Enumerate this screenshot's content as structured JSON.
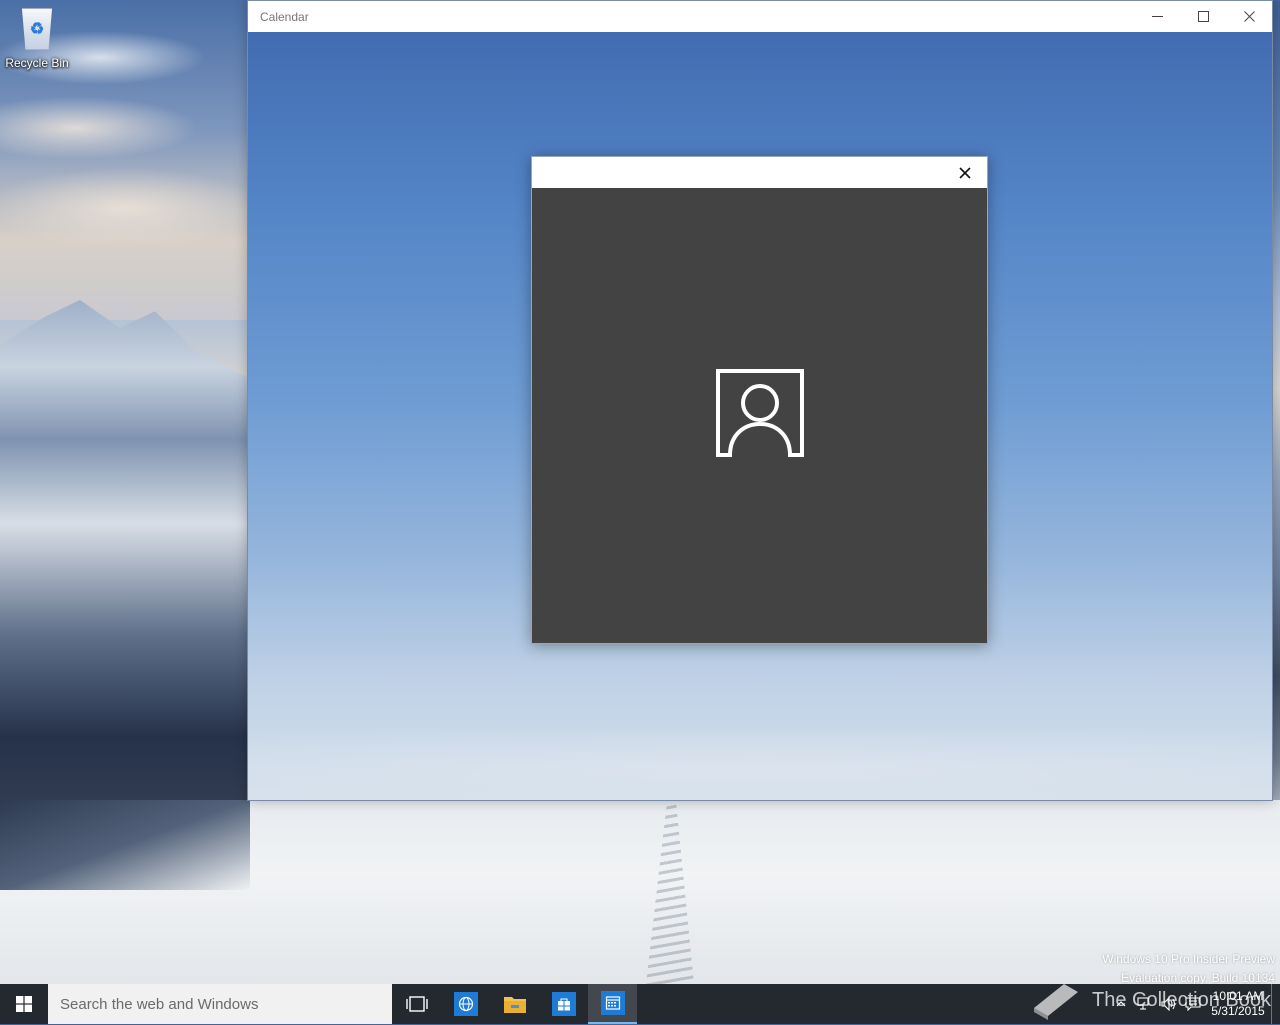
{
  "desktop": {
    "icons": [
      {
        "label": "Recycle Bin",
        "icon": "recycle-bin-icon"
      }
    ],
    "watermark": {
      "line1": "Windows 10 Pro Insider Preview",
      "line2": "Evaluation copy. Build 10134"
    },
    "site_watermark": "The Collection Book"
  },
  "window": {
    "title": "Calendar",
    "controls": {
      "minimize": "minimize-icon",
      "maximize": "maximize-icon",
      "close": "close-icon"
    }
  },
  "dialog": {
    "close_icon": "close-icon",
    "body_icon": "account-icon"
  },
  "taskbar": {
    "search_placeholder": "Search the web and Windows",
    "pinned": [
      {
        "name": "task-view",
        "icon": "task-view-icon"
      },
      {
        "name": "edge",
        "icon": "globe-icon",
        "color": "#1e7bd6"
      },
      {
        "name": "file-explorer",
        "icon": "folder-icon",
        "color": "#f2c14e"
      },
      {
        "name": "store",
        "icon": "store-icon",
        "color": "#1e7bd6"
      },
      {
        "name": "calendar",
        "icon": "calendar-icon",
        "color": "#1e7bd6",
        "active": true
      }
    ],
    "tray": {
      "icons": [
        "chevron-up-icon",
        "network-icon",
        "volume-icon",
        "action-center-icon"
      ],
      "time": "10:01 AM",
      "date": "5/31/2015"
    }
  },
  "colors": {
    "dialog_body": "#434343",
    "taskbar": "#14181e",
    "accent": "#1e7bd6"
  }
}
